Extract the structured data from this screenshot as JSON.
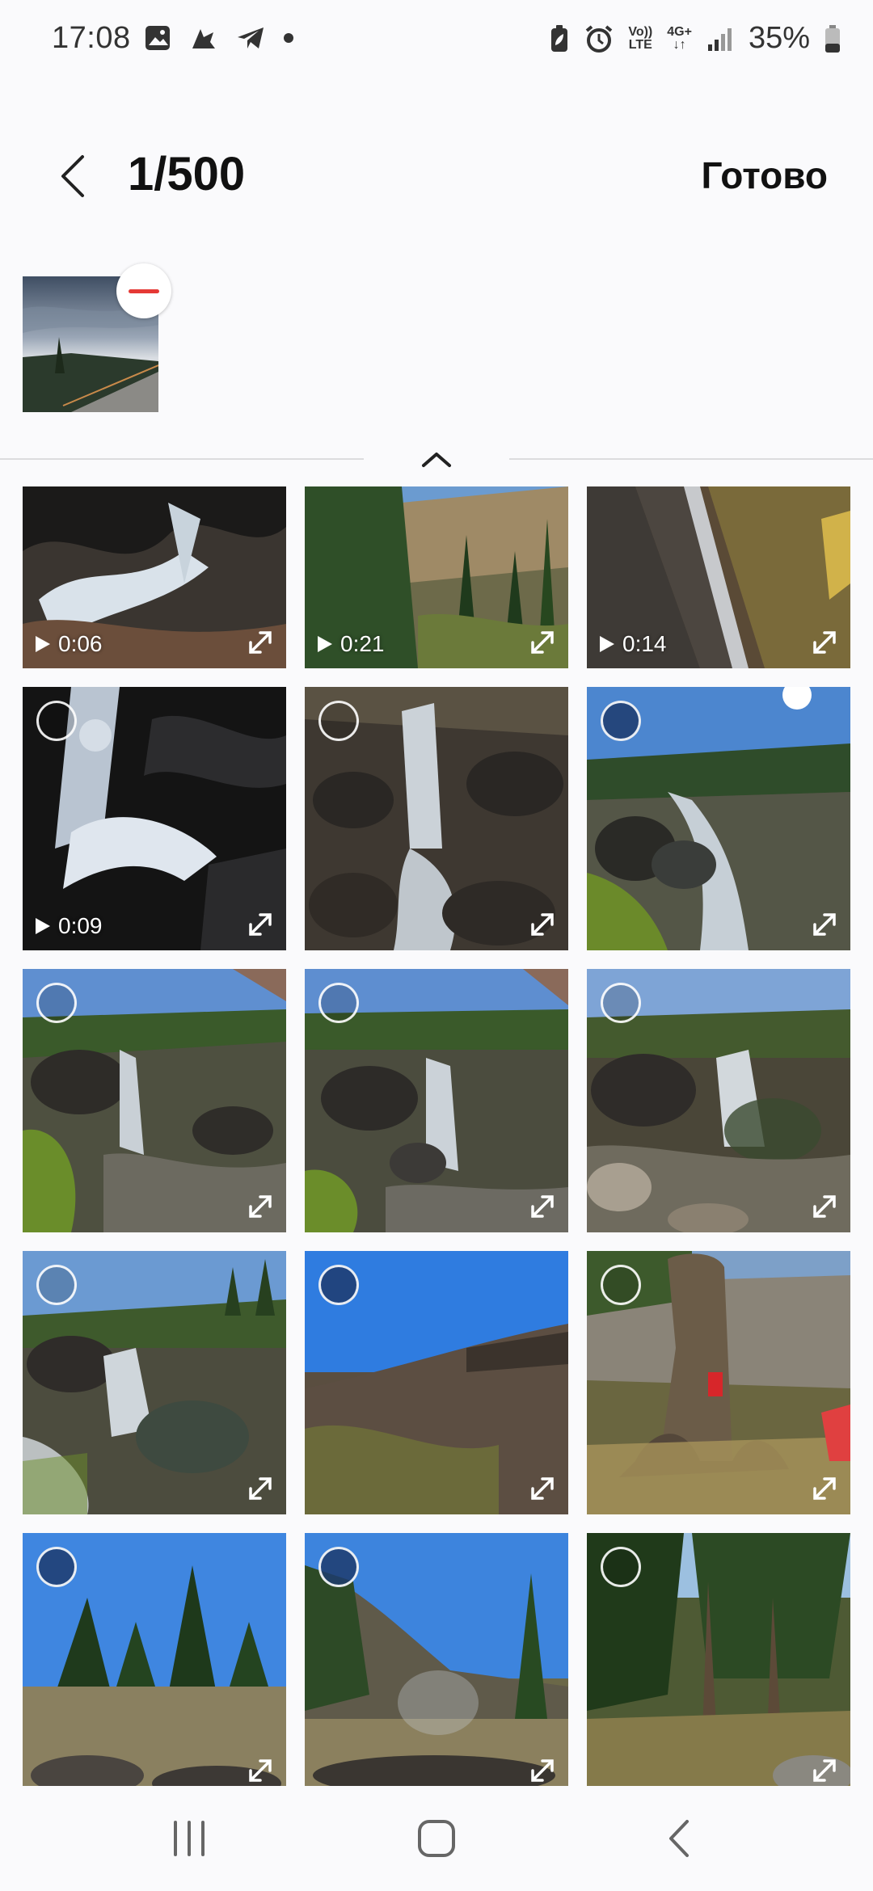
{
  "status_bar": {
    "time": "17:08",
    "left_icons": [
      "gallery-icon",
      "app-icon",
      "telegram-icon",
      "dot-icon"
    ],
    "volte_top": "Vo))",
    "volte_bottom": "LTE",
    "network_label": "4G+",
    "battery_percent": "35%"
  },
  "header": {
    "counter": "1/500",
    "done_label": "Готово"
  },
  "selected_tray": {
    "count": 1
  },
  "grid": {
    "tiles": [
      {
        "duration": "0:06",
        "type": "video"
      },
      {
        "duration": "0:21",
        "type": "video"
      },
      {
        "duration": "0:14",
        "type": "video"
      },
      {
        "duration": "0:09",
        "type": "video"
      },
      {
        "duration": "",
        "type": "photo"
      },
      {
        "duration": "",
        "type": "photo"
      },
      {
        "duration": "",
        "type": "photo"
      },
      {
        "duration": "",
        "type": "photo"
      },
      {
        "duration": "",
        "type": "photo"
      },
      {
        "duration": "",
        "type": "photo"
      },
      {
        "duration": "",
        "type": "photo"
      },
      {
        "duration": "",
        "type": "photo"
      },
      {
        "duration": "",
        "type": "photo"
      },
      {
        "duration": "",
        "type": "photo"
      },
      {
        "duration": "",
        "type": "photo"
      }
    ]
  },
  "colors": {
    "remove": "#e53935",
    "background": "#fafafc"
  },
  "navbar": {
    "icons": [
      "recent-apps-icon",
      "home-icon",
      "back-icon"
    ]
  }
}
